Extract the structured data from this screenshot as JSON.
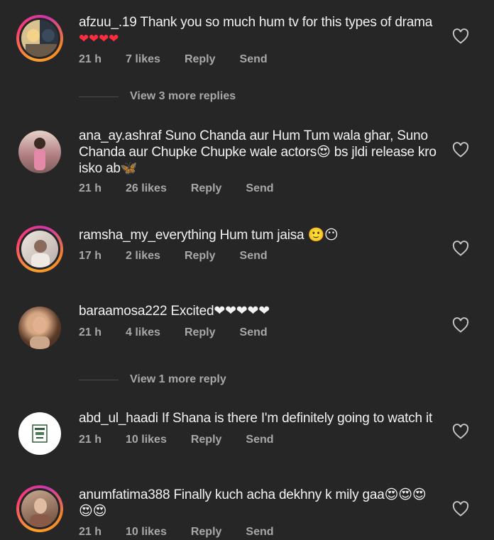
{
  "comments": [
    {
      "username": "afzuu_.19",
      "text": "Thank you so much hum tv for this types of drama",
      "line2": "❤❤❤❤",
      "time": "21 h",
      "likes": "7 likes",
      "reply": "Reply",
      "send": "Send",
      "avatar_colors": [
        "#c9b38a",
        "#27303a"
      ],
      "view_more": "View 3 more replies"
    },
    {
      "username": "ana_ay.ashraf",
      "text": "Suno Chanda aur Hum Tum wala ghar, Suno",
      "line2": "Chanda aur Chupke Chupke wale actors😍 bs jldi release kro",
      "line3": "isko ab🦋",
      "time": "21 h",
      "likes": "26 likes",
      "reply": "Reply",
      "send": "Send",
      "avatar_colors": [
        "#b98a8a",
        "#e9c8c0"
      ]
    },
    {
      "username": "ramsha_my_everything",
      "text": "Hum tum jaisa 🙂😶",
      "time": "17 h",
      "likes": "2 likes",
      "reply": "Reply",
      "send": "Send",
      "avatar_colors": [
        "#d8cfc8",
        "#a89e98"
      ]
    },
    {
      "username": "baraamosa222",
      "text": "Excited❤❤❤❤❤",
      "time": "21 h",
      "likes": "4 likes",
      "reply": "Reply",
      "send": "Send",
      "avatar_colors": [
        "#6b4c38",
        "#c49a78"
      ],
      "view_more": "View 1 more reply"
    },
    {
      "username": "abd_ul_haadi",
      "text": "If Shana is there I'm definitely going to watch it",
      "time": "21 h",
      "likes": "10 likes",
      "reply": "Reply",
      "send": "Send",
      "avatar_colors": [
        "#ffffff",
        "#2f5d3a"
      ]
    },
    {
      "username": "anumfatima388",
      "text": "Finally kuch acha dekhny k mily gaa😍😍😍",
      "line2": "😍😍",
      "time": "21 h",
      "likes": "10 likes",
      "reply": "Reply",
      "send": "Send",
      "avatar_colors": [
        "#8a6a58",
        "#d8b8a0"
      ]
    }
  ]
}
